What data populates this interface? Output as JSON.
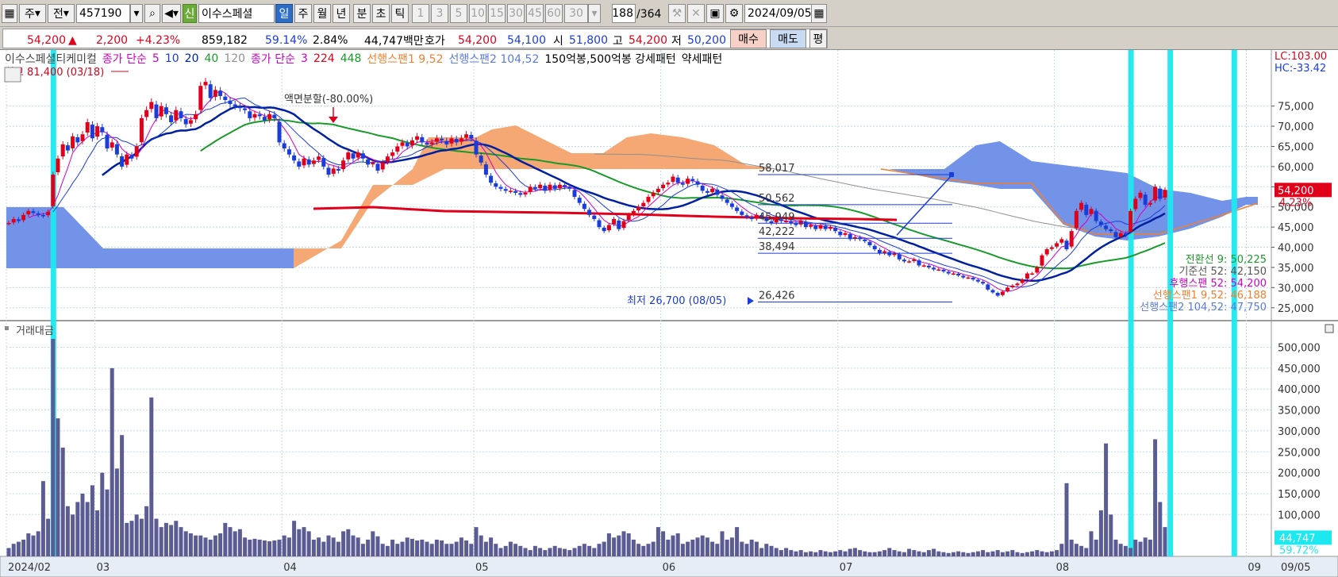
{
  "toolbar": {
    "market": "주",
    "scope": "전",
    "code": "457190",
    "badge": "신",
    "stock_name": "이수스페셜",
    "periods": [
      "일",
      "주",
      "월",
      "년",
      "분",
      "초",
      "틱"
    ],
    "selected_period": "일",
    "minute_options": [
      "1",
      "3",
      "5",
      "10",
      "15",
      "30",
      "45",
      "60"
    ],
    "minute_value": "30",
    "count": "188",
    "total": "/364",
    "date": "2024/09/05"
  },
  "quote": {
    "price": "54,200",
    "change_arrow": "▲",
    "change": "2,200",
    "change_pct": "+4.23%",
    "volume": "859,182",
    "volume_ratio": "59.14%",
    "turnover": "2.84%",
    "amount": "44,747백만",
    "hoga_label": "호가",
    "ask": "54,200",
    "bid": "54,100",
    "open_label": "시",
    "open": "51,800",
    "high_label": "고",
    "high": "54,200",
    "low_label": "저",
    "low": "50,200",
    "buy_label": "매수",
    "sell_label": "매도",
    "avg_label": "평"
  },
  "legend": {
    "title": "이수스페셜티케미컬",
    "ma_label": "종가 단순",
    "ma_periods": [
      "5",
      "10",
      "20",
      "40",
      "120"
    ],
    "ma2_label": "종가 단순",
    "ma2_periods": [
      "3",
      "224",
      "448"
    ],
    "span1": "선행스팬1 9,52",
    "span2": "선행스팬2 104,52",
    "pattern": "150억봉,500억봉 강세패턴",
    "weak": "약세패턴"
  },
  "annotations": {
    "high": "최고 81,400 (03/18)",
    "split": "액면분할(-80.00%)",
    "low": "최저 26,700 (08/05)",
    "fib": [
      "58,017",
      "50,562",
      "45,949",
      "42,222",
      "38,494",
      "26,426"
    ]
  },
  "right_labels": {
    "lc": "LC:103.00",
    "hc": "HC:-33.42",
    "price_tag": "54,200",
    "pct_tag": "4.23%",
    "vol_tag": "44,747",
    "vol_pct": "59.72%",
    "ichimoku": [
      "전환선 9: 50,225",
      "기준선 52: 42,150",
      "후행스팬 52: 54,200",
      "선행스팬1 9,52: 46,188",
      "선행스팬2 104,52: 47,750"
    ]
  },
  "volume_panel": {
    "title": "거래대금"
  },
  "colors": {
    "up": "#e0001a",
    "down": "#1a3cd8",
    "span1_cloud": "#f4a36c",
    "span2_cloud": "#6b8de8",
    "highlight": "#1ee8ef",
    "volume": "#5c5c94"
  },
  "chart_data": {
    "type": "candlestick",
    "price_axis": {
      "ticks": [
        25000,
        30000,
        35000,
        40000,
        45000,
        50000,
        55000,
        60000,
        65000,
        70000,
        75000
      ],
      "ylim": [
        22000,
        83000
      ]
    },
    "volume_axis": {
      "ticks": [
        100000,
        150000,
        200000,
        250000,
        300000,
        350000,
        400000,
        450000,
        500000
      ],
      "ylim": [
        0,
        520000
      ]
    },
    "x_labels": [
      {
        "i": 0,
        "text": "2024/02"
      },
      {
        "i": 18,
        "text": "03"
      },
      {
        "i": 56,
        "text": "04"
      },
      {
        "i": 95,
        "text": "05"
      },
      {
        "i": 133,
        "text": "06"
      },
      {
        "i": 169,
        "text": "07"
      },
      {
        "i": 213,
        "text": "08"
      },
      {
        "i": 252,
        "text": "09"
      }
    ],
    "x_last_label": "09/05",
    "highlights": [
      9,
      228,
      236,
      249
    ],
    "closes": [
      46000,
      47000,
      46500,
      48000,
      49000,
      48500,
      48000,
      47800,
      48800,
      58000,
      62000,
      65500,
      64000,
      67500,
      66000,
      68000,
      71000,
      67000,
      70000,
      68500,
      64500,
      66000,
      63000,
      60000,
      63000,
      62000,
      65000,
      72000,
      74000,
      76000,
      72000,
      75000,
      73000,
      71000,
      74000,
      72000,
      70500,
      71500,
      73000,
      80000,
      81000,
      77000,
      79000,
      77500,
      76500,
      75500,
      75000,
      74500,
      74000,
      72000,
      73000,
      72500,
      71500,
      73000,
      72000,
      66000,
      64500,
      63000,
      61500,
      60000,
      62000,
      60500,
      61500,
      62500,
      60000,
      58000,
      59500,
      59000,
      61500,
      63500,
      62000,
      63500,
      62000,
      60500,
      61000,
      59000,
      61000,
      62500,
      63500,
      65000,
      66000,
      65000,
      66500,
      67500,
      66000,
      65500,
      66000,
      67000,
      66500,
      65500,
      67000,
      66000,
      67000,
      68000,
      67000,
      63000,
      61000,
      58000,
      56000,
      55000,
      54500,
      54000,
      54000,
      53500,
      53000,
      53500,
      55000,
      54500,
      55500,
      54000,
      55500,
      54500,
      55500,
      55000,
      54500,
      52500,
      51000,
      49500,
      48000,
      47000,
      45000,
      44000,
      45500,
      47000,
      44500,
      46500,
      48000,
      49000,
      50000,
      51000,
      52500,
      53500,
      54500,
      55500,
      56000,
      57500,
      56000,
      55500,
      57000,
      56500,
      55500,
      54000,
      53500,
      54500,
      53000,
      52000,
      51000,
      50000,
      49000,
      48000,
      47500,
      47000,
      48000,
      47500,
      46500,
      46000,
      47000,
      46500,
      46500,
      46000,
      45500,
      46500,
      45000,
      45500,
      44500,
      45500,
      44500,
      45000,
      44000,
      43000,
      43500,
      42000,
      42500,
      42000,
      41500,
      40500,
      39500,
      38500,
      39000,
      38000,
      38500,
      37000,
      36500,
      36500,
      37000,
      35500,
      35500,
      35000,
      34500,
      34500,
      34000,
      33500,
      33500,
      33000,
      32500,
      32500,
      32000,
      31500,
      31000,
      29500,
      28800,
      28000,
      29000,
      30000,
      30500,
      31000,
      32000,
      33500,
      33500,
      35000,
      38000,
      39500,
      40000,
      41000,
      42000,
      39500,
      44000,
      49000,
      51000,
      48000,
      49500,
      46500,
      45500,
      44500,
      44000,
      42500,
      43500,
      43000,
      49000,
      52000,
      53500,
      50500,
      51000,
      55000,
      52000,
      54200
    ],
    "volume": [
      20000,
      30000,
      35000,
      40000,
      55000,
      50000,
      60000,
      180000,
      90000,
      520000,
      330000,
      260000,
      120000,
      100000,
      130000,
      150000,
      130000,
      170000,
      110000,
      200000,
      160000,
      450000,
      210000,
      290000,
      80000,
      85000,
      100000,
      90000,
      120000,
      380000,
      90000,
      70000,
      80000,
      75000,
      85000,
      70000,
      60000,
      55000,
      50000,
      50000,
      45000,
      40000,
      50000,
      55000,
      80000,
      70000,
      60000,
      65000,
      45000,
      40000,
      42000,
      40000,
      38000,
      36000,
      38000,
      40000,
      50000,
      45000,
      85000,
      65000,
      70000,
      60000,
      40000,
      45000,
      35000,
      50000,
      45000,
      35000,
      60000,
      65000,
      50000,
      45000,
      30000,
      40000,
      60000,
      48000,
      30000,
      25000,
      40000,
      30000,
      35000,
      45000,
      42000,
      38000,
      40000,
      35000,
      30000,
      40000,
      38000,
      30000,
      30000,
      35000,
      45000,
      38000,
      30000,
      70000,
      50000,
      35000,
      45000,
      30000,
      20000,
      25000,
      35000,
      30000,
      25000,
      20000,
      15000,
      25000,
      20000,
      15000,
      20000,
      25000,
      20000,
      18000,
      15000,
      20000,
      25000,
      30000,
      25000,
      20000,
      30000,
      35000,
      55000,
      45000,
      50000,
      60000,
      55000,
      40000,
      30000,
      25000,
      30000,
      35000,
      70000,
      60000,
      40000,
      50000,
      55000,
      30000,
      35000,
      40000,
      45000,
      50000,
      45000,
      35000,
      30000,
      60000,
      40000,
      45000,
      70000,
      35000,
      30000,
      40000,
      35000,
      20000,
      30000,
      25000,
      20000,
      15000,
      20000,
      15000,
      12000,
      15000,
      10000,
      12000,
      10000,
      15000,
      12000,
      10000,
      12000,
      15000,
      12000,
      18000,
      20000,
      15000,
      12000,
      10000,
      10000,
      12000,
      15000,
      20000,
      15000,
      12000,
      10000,
      18000,
      15000,
      12000,
      10000,
      15000,
      18000,
      12000,
      10000,
      8000,
      10000,
      12000,
      10000,
      8000,
      10000,
      12000,
      15000,
      10000,
      12000,
      15000,
      10000,
      12000,
      15000,
      10000,
      8000,
      10000,
      12000,
      15000,
      12000,
      10000,
      12000,
      15000,
      30000,
      175000,
      40000,
      30000,
      25000,
      20000,
      60000,
      40000,
      110000,
      270000,
      100000,
      40000,
      30000,
      25000,
      20000,
      40000,
      35000,
      45000,
      40000,
      280000,
      130000,
      70000,
      80000,
      70000,
      50000,
      35000
    ],
    "ma5": "computed from closes",
    "ichimoku_note": "clouds, moving averages and fib lines approximated from picture"
  }
}
